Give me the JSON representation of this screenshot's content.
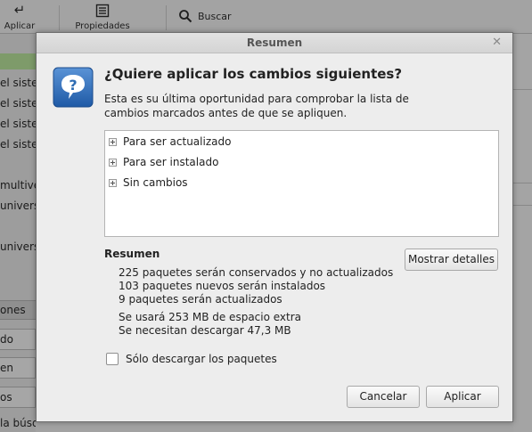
{
  "window": {
    "title": "Resumen"
  },
  "toolbar": {
    "apply_label": "Aplicar",
    "properties_label": "Propiedades",
    "search_label": "Buscar"
  },
  "background": {
    "list_items": [
      "el sistema",
      "el sistema",
      "el sistema",
      "el sistema",
      "multiverse",
      "universe",
      "universe"
    ],
    "group_label": "ones",
    "side_buttons": [
      "do",
      "en",
      "os"
    ],
    "bottom_label": "la búsqueda"
  },
  "dialog": {
    "heading": "¿Quiere aplicar los cambios siguientes?",
    "intro": "Esta es su última oportunidad para comprobar la lista de cambios marcados antes de que se apliquen.",
    "tree_items": [
      {
        "label": "Para ser actualizado"
      },
      {
        "label": "Para ser instalado"
      },
      {
        "label": "Sin cambios"
      }
    ],
    "summary_title": "Resumen",
    "summary_lines": [
      "225 paquetes serán conservados y no actualizados",
      "103 paquetes nuevos serán instalados",
      "9 paquetes serán actualizados",
      "Se usará 253 MB de espacio extra",
      "Se necesitan descargar 47,3 MB"
    ],
    "details_button": "Mostrar detalles",
    "download_only": {
      "label": "Sólo descargar los paquetes",
      "checked": false
    },
    "cancel_button": "Cancelar",
    "apply_button": "Aplicar"
  },
  "colors": {
    "dialog_bg": "#ededed",
    "accent_green": "#7e9b6a",
    "question_icon_blue": "#2f6db3"
  },
  "icons": {
    "apply": "apply-arrow-icon",
    "properties": "properties-icon",
    "search": "search-icon",
    "close": "close-icon",
    "question": "question-icon",
    "expander": "expander-plus-icon"
  }
}
